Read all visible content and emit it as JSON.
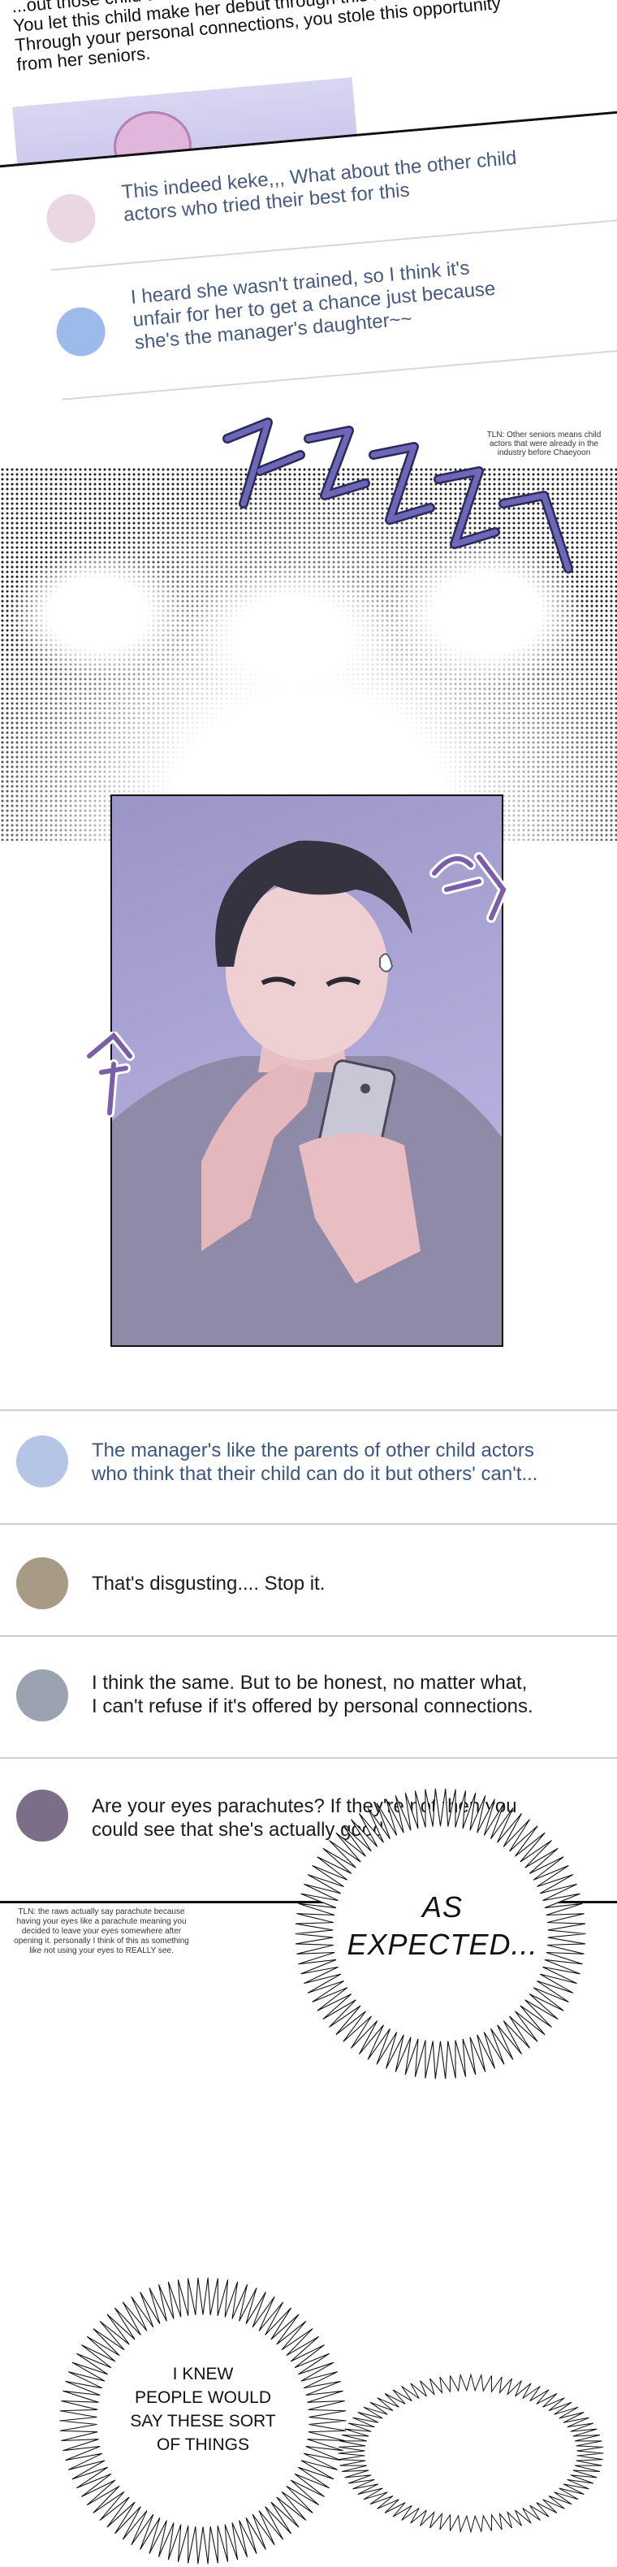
{
  "top_panel": {
    "text_lines": [
      "...out those child actors who needed this opportunity.",
      "You let this child make her debut through this music video...",
      "Through your personal connections, you stole this opportunity",
      "from her seniors."
    ],
    "comments": [
      {
        "lines": [
          "This indeed keke,,, What about the other child",
          "actors who tried their best for this"
        ],
        "avatar_color": "#e9d7e4"
      },
      {
        "lines": [
          "I heard she wasn't trained, so I think it's",
          "unfair for her to get a chance just because",
          "she's the manager's daughter~~"
        ],
        "avatar_color": "#9dbbea"
      }
    ]
  },
  "tl_note_top": "TLN: Other seniors means child actors that were already in the industry before Chaeyoon",
  "comments": [
    {
      "lines": [
        "The manager's like the parents of other child actors",
        "who think that their child can do it but others' can't..."
      ],
      "avatar_color": "#b5c5e6",
      "text_color": "#3d5680"
    },
    {
      "lines": [
        "That's disgusting.... Stop it."
      ],
      "avatar_color": "#a89b86",
      "text_color": "#1c1c1c"
    },
    {
      "lines": [
        "I think the same. But to be honest, no matter what,",
        "I can't refuse if it's offered by personal connections."
      ],
      "avatar_color": "#9aa3af",
      "text_color": "#1c1c1c"
    },
    {
      "lines": [
        "Are your eyes parachutes? If they're not then you",
        "could see that she's actually good."
      ],
      "avatar_color": "#7c6e88",
      "text_color": "#1c1c1c"
    }
  ],
  "tl_note_bottom": "TLN: the raws actually say parachute because having your eyes like a parachute meaning you decided to leave your eyes somewhere after opening it. personally I think of this as something like not using your eyes to REALLY see.",
  "bubble_1_lines": [
    "AS",
    "EXPECTED..."
  ],
  "bubble_2_lines": [
    "I KNEW",
    "PEOPLE WOULD",
    "SAY THESE SORT",
    "OF THINGS"
  ],
  "colors": {
    "sfx_purple": "#5a54a0",
    "panel_bg": "#a9a3d3",
    "comment_text_blue": "#475a7e"
  },
  "icons": [
    "phone-icon",
    "sweat-drop-icon"
  ]
}
